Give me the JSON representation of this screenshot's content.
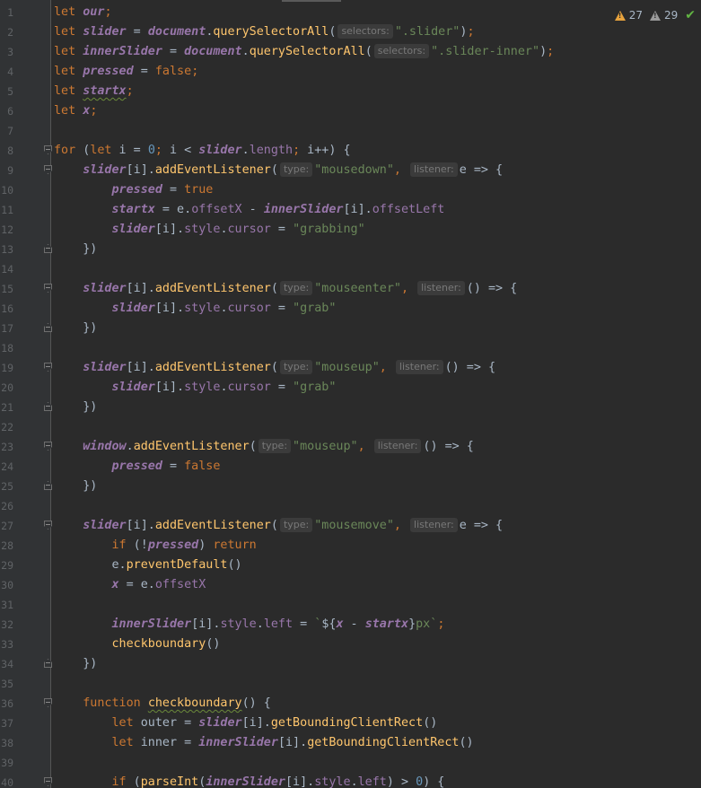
{
  "inspection": {
    "warnings": "27",
    "weak_warnings": "29"
  },
  "colors": {
    "background": "#2b2b2b",
    "gutter": "#313335",
    "keyword": "#cc7832",
    "global_variable": "#9876aa",
    "function": "#ffc66d",
    "string": "#6a8759",
    "number": "#6897bb",
    "default_text": "#a9b7c6"
  },
  "lines": [
    {
      "n": "1",
      "fold": "",
      "tokens": [
        [
          "kw",
          "let"
        ],
        [
          "t",
          " "
        ],
        [
          "gv",
          "our"
        ],
        [
          "kw",
          ";"
        ]
      ]
    },
    {
      "n": "2",
      "fold": "",
      "tokens": [
        [
          "kw",
          "let"
        ],
        [
          "t",
          " "
        ],
        [
          "gv",
          "slider"
        ],
        [
          "t",
          " = "
        ],
        [
          "gv",
          "document"
        ],
        [
          "t",
          "."
        ],
        [
          "fn",
          "querySelectorAll"
        ],
        [
          "t",
          "("
        ],
        [
          "h",
          "selectors:"
        ],
        [
          "str",
          "\".slider\""
        ],
        [
          "t",
          ")"
        ],
        [
          "kw",
          ";"
        ]
      ]
    },
    {
      "n": "3",
      "fold": "",
      "tokens": [
        [
          "kw",
          "let"
        ],
        [
          "t",
          " "
        ],
        [
          "gv",
          "innerSlider"
        ],
        [
          "t",
          " = "
        ],
        [
          "gv",
          "document"
        ],
        [
          "t",
          "."
        ],
        [
          "fn",
          "querySelectorAll"
        ],
        [
          "t",
          "("
        ],
        [
          "h",
          "selectors:"
        ],
        [
          "str",
          "\".slider-inner\""
        ],
        [
          "t",
          ")"
        ],
        [
          "kw",
          ";"
        ]
      ]
    },
    {
      "n": "4",
      "fold": "",
      "tokens": [
        [
          "kw",
          "let"
        ],
        [
          "t",
          " "
        ],
        [
          "gv",
          "pressed"
        ],
        [
          "t",
          " = "
        ],
        [
          "kw",
          "false"
        ],
        [
          "kw",
          ";"
        ]
      ]
    },
    {
      "n": "5",
      "fold": "",
      "tokens": [
        [
          "kw",
          "let"
        ],
        [
          "t",
          " "
        ],
        [
          "gvs",
          "startx"
        ],
        [
          "kw",
          ";"
        ]
      ]
    },
    {
      "n": "6",
      "fold": "",
      "tokens": [
        [
          "kw",
          "let"
        ],
        [
          "t",
          " "
        ],
        [
          "gv",
          "x"
        ],
        [
          "kw",
          ";"
        ]
      ]
    },
    {
      "n": "7",
      "fold": "",
      "tokens": []
    },
    {
      "n": "8",
      "fold": "start",
      "tokens": [
        [
          "kw",
          "for"
        ],
        [
          "t",
          " ("
        ],
        [
          "kw",
          "let"
        ],
        [
          "t",
          " i = "
        ],
        [
          "num",
          "0"
        ],
        [
          "kw",
          ";"
        ],
        [
          "t",
          " i < "
        ],
        [
          "gv",
          "slider"
        ],
        [
          "t",
          "."
        ],
        [
          "prop",
          "length"
        ],
        [
          "kw",
          ";"
        ],
        [
          "t",
          " i++) {"
        ]
      ]
    },
    {
      "n": "9",
      "fold": "start",
      "tokens": [
        [
          "t",
          "    "
        ],
        [
          "gv",
          "slider"
        ],
        [
          "t",
          "[i]."
        ],
        [
          "fn",
          "addEventListener"
        ],
        [
          "t",
          "("
        ],
        [
          "h",
          "type:"
        ],
        [
          "str",
          "\"mousedown\""
        ],
        [
          "kw",
          ","
        ],
        [
          "t",
          " "
        ],
        [
          "h",
          "listener:"
        ],
        [
          "t",
          "e => {"
        ]
      ]
    },
    {
      "n": "10",
      "fold": "",
      "tokens": [
        [
          "t",
          "        "
        ],
        [
          "gv",
          "pressed"
        ],
        [
          "t",
          " = "
        ],
        [
          "kw",
          "true"
        ]
      ]
    },
    {
      "n": "11",
      "fold": "",
      "tokens": [
        [
          "t",
          "        "
        ],
        [
          "gv",
          "startx"
        ],
        [
          "t",
          " = e."
        ],
        [
          "prop",
          "offsetX"
        ],
        [
          "t",
          " - "
        ],
        [
          "gv",
          "innerSlider"
        ],
        [
          "t",
          "[i]."
        ],
        [
          "prop",
          "offsetLeft"
        ]
      ]
    },
    {
      "n": "12",
      "fold": "",
      "tokens": [
        [
          "t",
          "        "
        ],
        [
          "gv",
          "slider"
        ],
        [
          "t",
          "[i]."
        ],
        [
          "prop",
          "style"
        ],
        [
          "t",
          "."
        ],
        [
          "prop",
          "cursor"
        ],
        [
          "t",
          " = "
        ],
        [
          "str",
          "\"grabbing\""
        ]
      ]
    },
    {
      "n": "13",
      "fold": "end",
      "tokens": [
        [
          "t",
          "    })"
        ]
      ]
    },
    {
      "n": "14",
      "fold": "",
      "tokens": []
    },
    {
      "n": "15",
      "fold": "start",
      "tokens": [
        [
          "t",
          "    "
        ],
        [
          "gv",
          "slider"
        ],
        [
          "t",
          "[i]."
        ],
        [
          "fn",
          "addEventListener"
        ],
        [
          "t",
          "("
        ],
        [
          "h",
          "type:"
        ],
        [
          "str",
          "\"mouseenter\""
        ],
        [
          "kw",
          ","
        ],
        [
          "t",
          " "
        ],
        [
          "h",
          "listener:"
        ],
        [
          "t",
          "() => {"
        ]
      ]
    },
    {
      "n": "16",
      "fold": "",
      "tokens": [
        [
          "t",
          "        "
        ],
        [
          "gv",
          "slider"
        ],
        [
          "t",
          "[i]."
        ],
        [
          "prop",
          "style"
        ],
        [
          "t",
          "."
        ],
        [
          "prop",
          "cursor"
        ],
        [
          "t",
          " = "
        ],
        [
          "str",
          "\"grab\""
        ]
      ]
    },
    {
      "n": "17",
      "fold": "end",
      "tokens": [
        [
          "t",
          "    })"
        ]
      ]
    },
    {
      "n": "18",
      "fold": "",
      "tokens": []
    },
    {
      "n": "19",
      "fold": "start",
      "tokens": [
        [
          "t",
          "    "
        ],
        [
          "gv",
          "slider"
        ],
        [
          "t",
          "[i]."
        ],
        [
          "fn",
          "addEventListener"
        ],
        [
          "t",
          "("
        ],
        [
          "h",
          "type:"
        ],
        [
          "str",
          "\"mouseup\""
        ],
        [
          "kw",
          ","
        ],
        [
          "t",
          " "
        ],
        [
          "h",
          "listener:"
        ],
        [
          "t",
          "() => {"
        ]
      ]
    },
    {
      "n": "20",
      "fold": "",
      "tokens": [
        [
          "t",
          "        "
        ],
        [
          "gv",
          "slider"
        ],
        [
          "t",
          "[i]."
        ],
        [
          "prop",
          "style"
        ],
        [
          "t",
          "."
        ],
        [
          "prop",
          "cursor"
        ],
        [
          "t",
          " = "
        ],
        [
          "str",
          "\"grab\""
        ]
      ]
    },
    {
      "n": "21",
      "fold": "end",
      "tokens": [
        [
          "t",
          "    })"
        ]
      ]
    },
    {
      "n": "22",
      "fold": "",
      "tokens": []
    },
    {
      "n": "23",
      "fold": "start",
      "tokens": [
        [
          "t",
          "    "
        ],
        [
          "gv",
          "window"
        ],
        [
          "t",
          "."
        ],
        [
          "fn",
          "addEventListener"
        ],
        [
          "t",
          "("
        ],
        [
          "h",
          "type:"
        ],
        [
          "str",
          "\"mouseup\""
        ],
        [
          "kw",
          ","
        ],
        [
          "t",
          " "
        ],
        [
          "h",
          "listener:"
        ],
        [
          "t",
          "() => {"
        ]
      ]
    },
    {
      "n": "24",
      "fold": "",
      "tokens": [
        [
          "t",
          "        "
        ],
        [
          "gv",
          "pressed"
        ],
        [
          "t",
          " = "
        ],
        [
          "kw",
          "false"
        ]
      ]
    },
    {
      "n": "25",
      "fold": "end",
      "tokens": [
        [
          "t",
          "    })"
        ]
      ]
    },
    {
      "n": "26",
      "fold": "",
      "tokens": []
    },
    {
      "n": "27",
      "fold": "start",
      "tokens": [
        [
          "t",
          "    "
        ],
        [
          "gv",
          "slider"
        ],
        [
          "t",
          "[i]."
        ],
        [
          "fn",
          "addEventListener"
        ],
        [
          "t",
          "("
        ],
        [
          "h",
          "type:"
        ],
        [
          "str",
          "\"mousemove\""
        ],
        [
          "kw",
          ","
        ],
        [
          "t",
          " "
        ],
        [
          "h",
          "listener:"
        ],
        [
          "t",
          "e => {"
        ]
      ]
    },
    {
      "n": "28",
      "fold": "",
      "tokens": [
        [
          "t",
          "        "
        ],
        [
          "kw",
          "if"
        ],
        [
          "t",
          " (!"
        ],
        [
          "gv",
          "pressed"
        ],
        [
          "t",
          ") "
        ],
        [
          "kw",
          "return"
        ]
      ]
    },
    {
      "n": "29",
      "fold": "",
      "tokens": [
        [
          "t",
          "        e."
        ],
        [
          "fn",
          "preventDefault"
        ],
        [
          "t",
          "()"
        ]
      ]
    },
    {
      "n": "30",
      "fold": "",
      "tokens": [
        [
          "t",
          "        "
        ],
        [
          "gv",
          "x"
        ],
        [
          "t",
          " = e."
        ],
        [
          "prop",
          "offsetX"
        ]
      ]
    },
    {
      "n": "31",
      "fold": "",
      "tokens": []
    },
    {
      "n": "32",
      "fold": "",
      "tokens": [
        [
          "t",
          "        "
        ],
        [
          "gv",
          "innerSlider"
        ],
        [
          "t",
          "[i]."
        ],
        [
          "prop",
          "style"
        ],
        [
          "t",
          "."
        ],
        [
          "prop",
          "left"
        ],
        [
          "t",
          " = "
        ],
        [
          "str",
          "`"
        ],
        [
          "t",
          "${"
        ],
        [
          "gv",
          "x"
        ],
        [
          "t",
          " - "
        ],
        [
          "gv",
          "startx"
        ],
        [
          "t",
          "}"
        ],
        [
          "str",
          "px`"
        ],
        [
          "kw",
          ";"
        ]
      ]
    },
    {
      "n": "33",
      "fold": "",
      "tokens": [
        [
          "t",
          "        "
        ],
        [
          "fn",
          "checkboundary"
        ],
        [
          "t",
          "()"
        ]
      ]
    },
    {
      "n": "34",
      "fold": "end",
      "tokens": [
        [
          "t",
          "    })"
        ]
      ]
    },
    {
      "n": "35",
      "fold": "",
      "tokens": []
    },
    {
      "n": "36",
      "fold": "start",
      "tokens": [
        [
          "t",
          "    "
        ],
        [
          "kw",
          "function"
        ],
        [
          "t",
          " "
        ],
        [
          "fns",
          "checkboundary"
        ],
        [
          "t",
          "() {"
        ]
      ]
    },
    {
      "n": "37",
      "fold": "",
      "tokens": [
        [
          "t",
          "        "
        ],
        [
          "kw",
          "let"
        ],
        [
          "t",
          " outer = "
        ],
        [
          "gv",
          "slider"
        ],
        [
          "t",
          "[i]."
        ],
        [
          "fn",
          "getBoundingClientRect"
        ],
        [
          "t",
          "()"
        ]
      ]
    },
    {
      "n": "38",
      "fold": "",
      "tokens": [
        [
          "t",
          "        "
        ],
        [
          "kw",
          "let"
        ],
        [
          "t",
          " inner = "
        ],
        [
          "gv",
          "innerSlider"
        ],
        [
          "t",
          "[i]."
        ],
        [
          "fn",
          "getBoundingClientRect"
        ],
        [
          "t",
          "()"
        ]
      ]
    },
    {
      "n": "39",
      "fold": "",
      "tokens": []
    },
    {
      "n": "40",
      "fold": "start",
      "tokens": [
        [
          "t",
          "        "
        ],
        [
          "kw",
          "if"
        ],
        [
          "t",
          " ("
        ],
        [
          "fn",
          "parseInt"
        ],
        [
          "t",
          "("
        ],
        [
          "gv",
          "innerSlider"
        ],
        [
          "t",
          "[i]."
        ],
        [
          "prop",
          "style"
        ],
        [
          "t",
          "."
        ],
        [
          "prop",
          "left"
        ],
        [
          "t",
          ") > "
        ],
        [
          "num",
          "0"
        ],
        [
          "t",
          ") {"
        ]
      ]
    }
  ]
}
